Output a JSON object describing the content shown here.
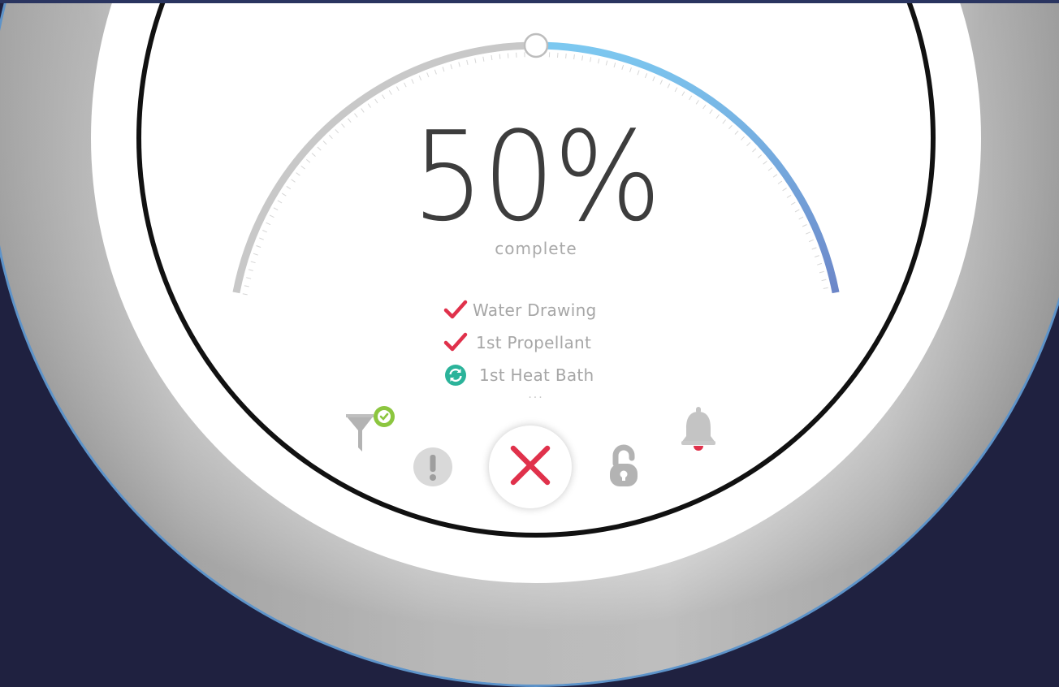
{
  "progress": {
    "percent_label": "50%",
    "value": 0.5,
    "status_word": "complete"
  },
  "steps": [
    {
      "label": "Water Drawing",
      "state": "done",
      "icon": "checkmark-icon"
    },
    {
      "label": "1st Propellant",
      "state": "done",
      "icon": "checkmark-icon"
    },
    {
      "label": "1st Heat Bath",
      "state": "in-progress",
      "icon": "sync-icon"
    }
  ],
  "more_indicator": "...",
  "controls": {
    "filter": {
      "icon": "filter-icon",
      "badge_icon": "check-badge-icon"
    },
    "alert": {
      "icon": "exclamation-icon"
    },
    "cancel": {
      "icon": "close-icon"
    },
    "lock": {
      "icon": "unlock-icon"
    },
    "bell": {
      "icon": "bell-icon"
    }
  },
  "colors": {
    "background": "#1f2140",
    "track": "#c8c8c8",
    "progress_start": "#7cc8f0",
    "progress_end": "#6c86c8",
    "check": "#e0314b",
    "sync": "#2bb39a",
    "badge": "#8cc63f",
    "cancel_x": "#e0314b",
    "icon_grey": "#bdbdbd"
  }
}
